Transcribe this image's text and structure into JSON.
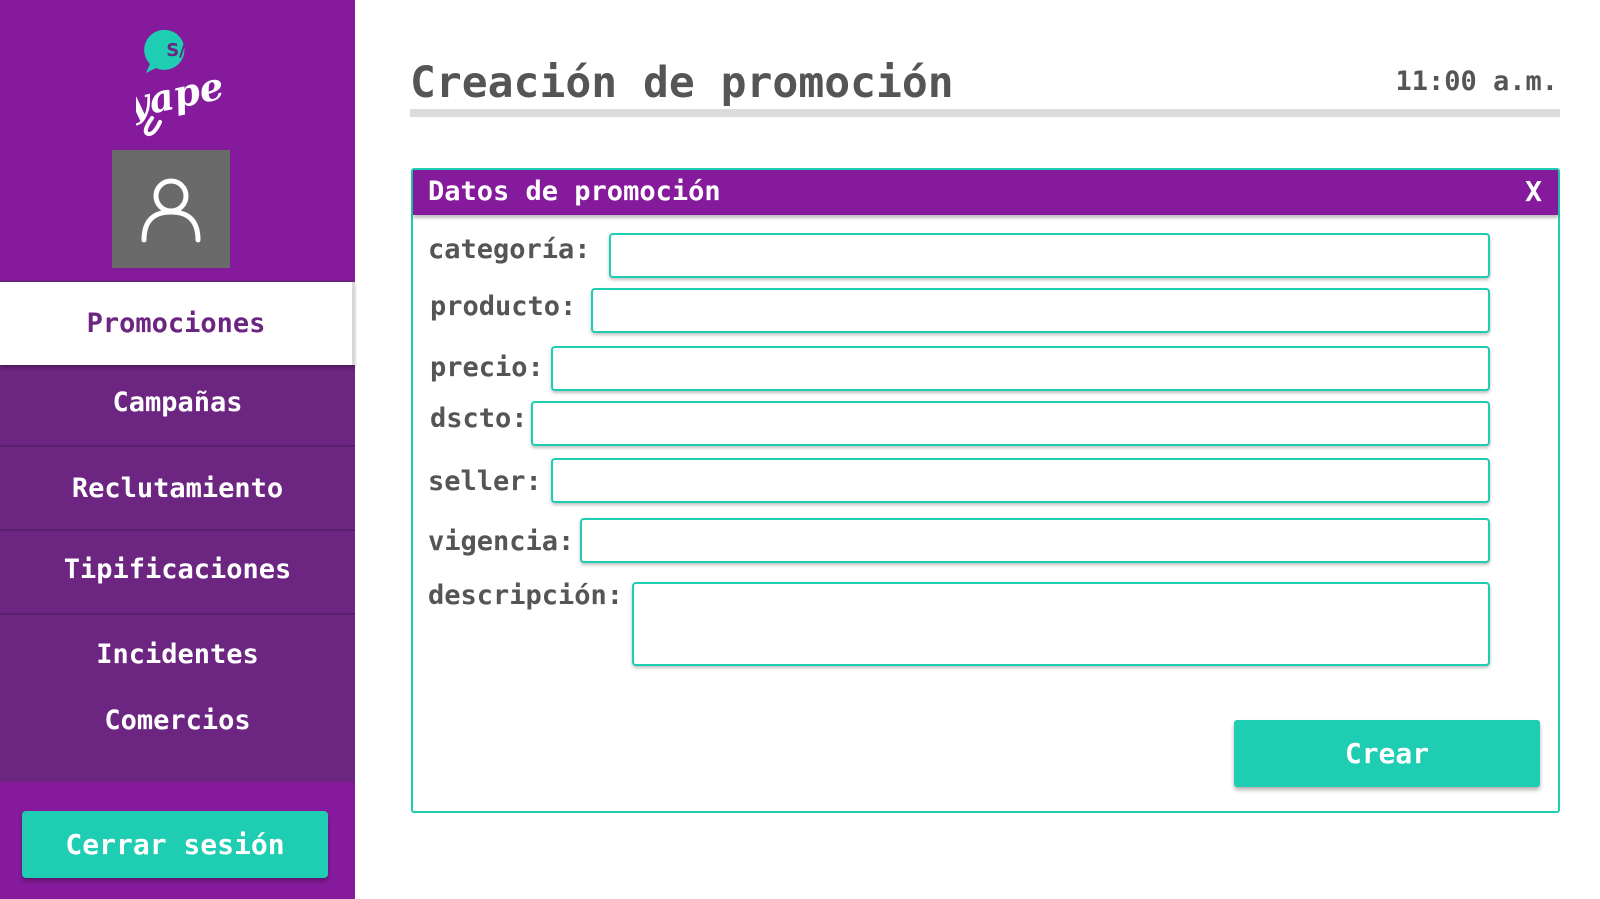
{
  "sidebar": {
    "logo": {
      "badge_text": "S/",
      "wordmark": "yape",
      "badge_color": "#1fcdb2"
    },
    "avatar_icon": "user-icon",
    "menu": [
      {
        "label": "Promociones",
        "active": true
      },
      {
        "label": "Campañas",
        "active": false
      },
      {
        "label": "Reclutamiento",
        "active": false
      },
      {
        "label": "Tipificaciones",
        "active": false
      },
      {
        "label": "Incidentes",
        "active": false
      },
      {
        "label": "Comercios",
        "active": false
      }
    ],
    "logout_label": "Cerrar sesión"
  },
  "header": {
    "title": "Creación de promoción",
    "time": "11:00 a.m."
  },
  "panel": {
    "title": "Datos de promoción",
    "close_label": "X",
    "fields": [
      {
        "label": "categoría:",
        "value": ""
      },
      {
        "label": "producto:",
        "value": ""
      },
      {
        "label": "precio:",
        "value": ""
      },
      {
        "label": "dscto:",
        "value": ""
      },
      {
        "label": "seller:",
        "value": ""
      },
      {
        "label": "vigencia:",
        "value": ""
      },
      {
        "label": "descripción:",
        "value": ""
      }
    ],
    "submit_label": "Crear"
  },
  "colors": {
    "brand_purple": "#861a9c",
    "menu_purple": "#6c2581",
    "accent_teal": "#1fcdb2",
    "text_gray": "#555555"
  }
}
